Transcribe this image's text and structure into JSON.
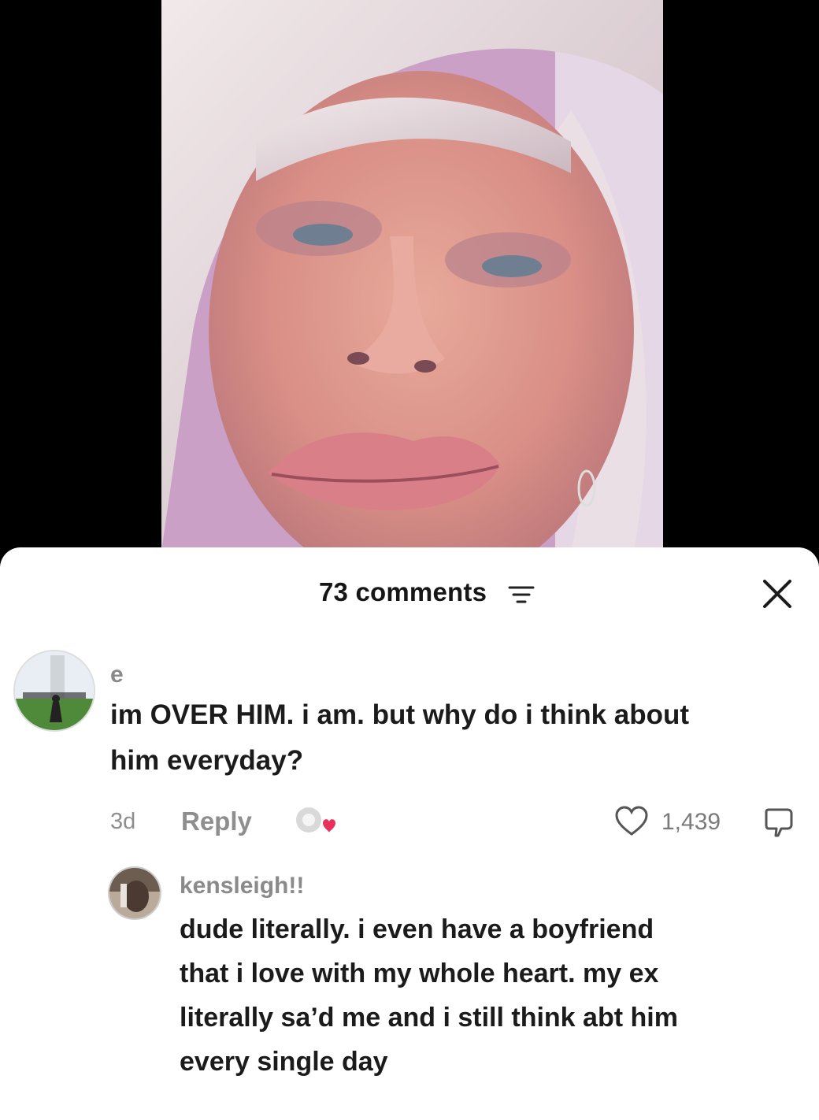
{
  "comments_sheet": {
    "count_label": "73 comments",
    "filter_icon": "filter-icon",
    "close_icon": "close-icon"
  },
  "comments": [
    {
      "username": "e",
      "text_line_1": "im OVER HIM. i am. but why do i think about",
      "text_line_2": "him everyday?",
      "time": "3d",
      "reply_label": "Reply",
      "likes": "1,439"
    },
    {
      "username": "kensleigh!!",
      "text_line_1": "dude literally. i even have a boyfriend",
      "text_line_2": "that i love with my whole heart. my ex",
      "text_line_3": "literally sa’d me and i still think abt him",
      "text_line_4": "every single day"
    }
  ],
  "colors": {
    "sheet_bg": "#ffffff",
    "text_primary": "#1b1b1b",
    "text_secondary": "#8e8e8e",
    "creator_heart": "#e8305a"
  }
}
